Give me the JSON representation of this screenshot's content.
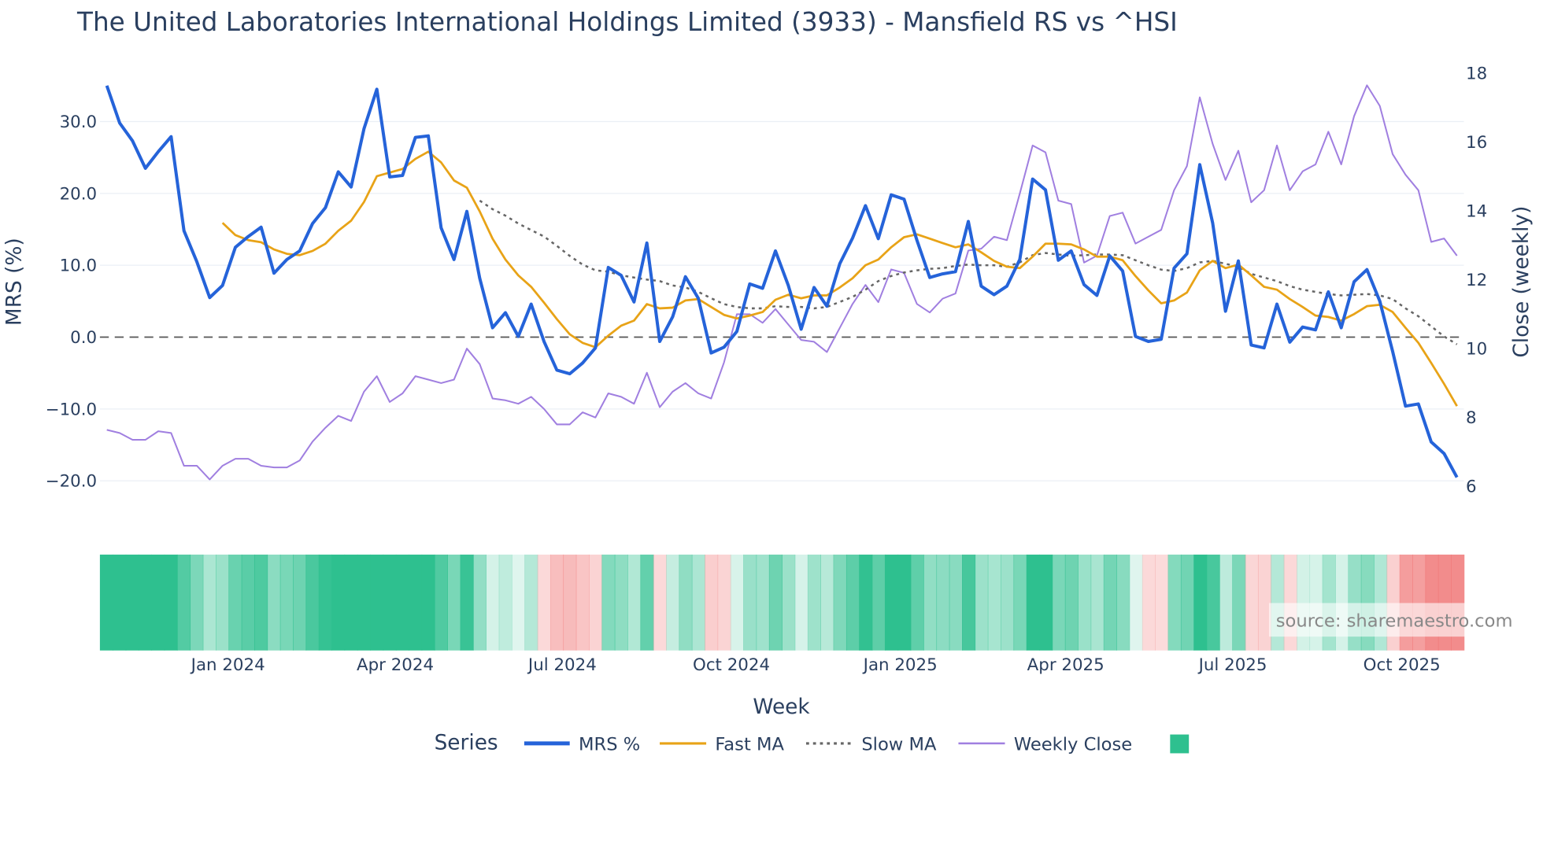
{
  "chart_data": {
    "type": "line",
    "title": "The United Laboratories International Holdings Limited (3933) - Mansfield RS vs ^HSI",
    "xlabel": "Week",
    "ylabel": "MRS (%)",
    "y2label": "Close (weekly)",
    "x_start": "2023-10-27",
    "x_step_days": 7,
    "x_ticks": [
      "Jan 2024",
      "Apr 2024",
      "Jul 2024",
      "Oct 2024",
      "Jan 2025",
      "Apr 2025",
      "Jul 2025",
      "Oct 2025"
    ],
    "ylim": [
      -24,
      37
    ],
    "y_ticks": [
      "30.0",
      "20.0",
      "10.0",
      "0.0",
      "−10.0",
      "−20.0"
    ],
    "y_tick_values": [
      30,
      20,
      10,
      0,
      -10,
      -20
    ],
    "y2lim": [
      6,
      18
    ],
    "y2_ticks": [
      "18",
      "16",
      "14",
      "12",
      "10",
      "8",
      "6"
    ],
    "y2_tick_values": [
      18,
      16,
      14,
      12,
      10,
      8,
      6
    ],
    "legend_title": "Series",
    "legend_position": "bottom",
    "source": "source: sharemaestro.com",
    "series": [
      {
        "name": "MRS %",
        "color": "#2563d9",
        "axis": "left",
        "values": [
          35,
          29.8,
          27.3,
          23.5,
          25.8,
          27.9,
          14.8,
          10.5,
          5.5,
          7.2,
          12.5,
          14,
          15.3,
          8.9,
          10.8,
          12,
          15.8,
          18,
          23,
          20.9,
          29,
          34.5,
          22.3,
          22.5,
          27.8,
          28,
          15.2,
          10.8,
          17.5,
          8.2,
          1.3,
          3.4,
          0.1,
          4.6,
          -0.6,
          -4.6,
          -5.1,
          -3.6,
          -1.5,
          9.7,
          8.6,
          4.9,
          13.1,
          -0.6,
          2.8,
          8.4,
          5.4,
          -2.2,
          -1.4,
          0.8,
          7.4,
          6.8,
          12,
          7.2,
          1.1,
          6.9,
          4.3,
          10.2,
          13.8,
          18.3,
          13.7,
          19.8,
          19.2,
          13.5,
          8.3,
          8.8,
          9.1,
          16.1,
          7.1,
          5.9,
          7.1,
          10.8,
          22,
          20.5,
          10.7,
          12,
          7.3,
          5.8,
          11.3,
          9.2,
          0.1,
          -0.6,
          -0.3,
          9.6,
          11.6,
          24,
          15.9,
          3.6,
          10.6,
          -1.1,
          -1.5,
          4.6,
          -0.7,
          1.4,
          1,
          6.3,
          1.3,
          7.7,
          9.4,
          5,
          -2,
          -9.6,
          -9.3,
          -14.6,
          -16.2,
          -19.5
        ]
      },
      {
        "name": "Fast MA",
        "color": "#e8a317",
        "axis": "left",
        "values": [
          15.9,
          14.2,
          13.5,
          13.2,
          12.2,
          11.6,
          11.4,
          12,
          13,
          14.8,
          16.2,
          18.8,
          22.4,
          22.9,
          23.4,
          24.8,
          25.8,
          24.3,
          21.8,
          20.8,
          17.5,
          13.7,
          10.8,
          8.6,
          7,
          4.8,
          2.5,
          0.4,
          -0.8,
          -1.4,
          0.2,
          1.6,
          2.3,
          4.6,
          4,
          4.1,
          5.1,
          5.3,
          4.2,
          3.1,
          2.6,
          3,
          3.5,
          5.2,
          5.9,
          5.4,
          5.8,
          5.8,
          6.9,
          8.2,
          10,
          10.8,
          12.5,
          13.9,
          14.3,
          13.7,
          13.1,
          12.5,
          12.9,
          11.8,
          10.6,
          9.8,
          9.6,
          11.2,
          13,
          13,
          12.9,
          12.2,
          11.2,
          11.2,
          10.7,
          8.5,
          6.5,
          4.7,
          5.1,
          6.2,
          9.3,
          10.6,
          9.6,
          10.1,
          8.6,
          7,
          6.6,
          5.3,
          4.2,
          3,
          2.8,
          2.3,
          3.2,
          4.3,
          4.5,
          3.5,
          1.3,
          -0.8,
          -3.6,
          -6.5,
          -9.6
        ]
      },
      {
        "name": "Slow MA",
        "color": "#666666",
        "axis": "left",
        "values": [
          19,
          17.8,
          16.9,
          15.8,
          14.9,
          14,
          12.7,
          11.3,
          10.1,
          9.3,
          9.1,
          8.6,
          8.3,
          8,
          7.8,
          7.2,
          6.9,
          6.3,
          5.4,
          4.6,
          4.2,
          4,
          4,
          4.3,
          4.2,
          4.2,
          4,
          4.2,
          4.9,
          5.6,
          6.6,
          7.8,
          8.5,
          9,
          9.3,
          9.5,
          9.6,
          9.9,
          10.1,
          10,
          10,
          9.8,
          10.4,
          11.4,
          11.7,
          11.5,
          11.3,
          11.4,
          11.5,
          11.5,
          11.4,
          10.7,
          10,
          9.4,
          9.2,
          9.6,
          10.4,
          10.6,
          10.2,
          9.8,
          8.8,
          8.3,
          7.8,
          7.1,
          6.6,
          6.3,
          6,
          5.8,
          5.9,
          6,
          5.8,
          5.3,
          4,
          2.9,
          1.5,
          0.1,
          -1
        ]
      },
      {
        "name": "Weekly Close",
        "color": "#a07fe0",
        "axis": "right",
        "values": [
          7.64,
          7.55,
          7.35,
          7.35,
          7.6,
          7.55,
          6.6,
          6.6,
          6.2,
          6.6,
          6.8,
          6.8,
          6.6,
          6.55,
          6.55,
          6.75,
          7.3,
          7.7,
          8.05,
          7.9,
          8.75,
          9.2,
          8.45,
          8.7,
          9.2,
          9.1,
          9,
          9.1,
          10,
          9.55,
          8.55,
          8.5,
          8.4,
          8.6,
          8.25,
          7.8,
          7.8,
          8.15,
          8,
          8.7,
          8.6,
          8.4,
          9.3,
          8.3,
          8.75,
          9,
          8.7,
          8.55,
          9.6,
          11,
          11,
          10.75,
          11.15,
          10.7,
          10.25,
          10.2,
          9.9,
          10.6,
          11.3,
          11.85,
          11.35,
          12.3,
          12.2,
          11.3,
          11.05,
          11.45,
          11.6,
          12.85,
          12.9,
          13.25,
          13.15,
          14.5,
          15.9,
          15.7,
          14.3,
          14.2,
          12.5,
          12.7,
          13.85,
          13.95,
          13.05,
          13.25,
          13.45,
          14.6,
          15.3,
          17.3,
          15.95,
          14.9,
          15.75,
          14.25,
          14.6,
          15.9,
          14.6,
          15.15,
          15.35,
          16.3,
          15.35,
          16.75,
          17.65,
          17.05,
          15.65,
          15.05,
          14.6,
          13.1,
          13.2,
          12.7
        ]
      }
    ],
    "heatmap_colors": {
      "positive": "#2ec08f",
      "negative": "#f07878"
    }
  }
}
